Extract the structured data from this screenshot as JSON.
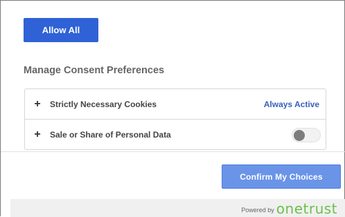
{
  "actions": {
    "allow_all_label": "Allow All",
    "confirm_label": "Confirm My Choices"
  },
  "consent": {
    "title": "Manage Consent Preferences",
    "items": [
      {
        "expand_symbol": "+",
        "label": "Strictly Necessary Cookies",
        "status": "Always Active"
      },
      {
        "expand_symbol": "+",
        "label": "Sale or Share of Personal Data",
        "toggle_on": false
      }
    ]
  },
  "footer": {
    "powered_by": "Powered by",
    "brand": "onetrust",
    "brand_color": "#6cc04a"
  },
  "colors": {
    "primary_button": "#2f62d6",
    "confirm_button": "#6a94e8",
    "active_text": "#3860be"
  }
}
